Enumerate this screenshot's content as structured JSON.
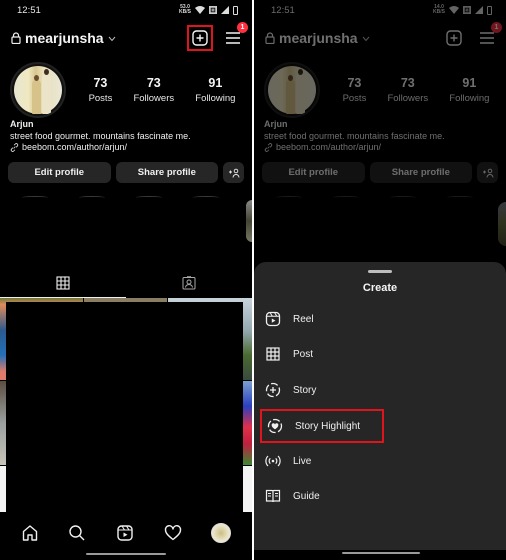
{
  "status_bar_left": {
    "time": "12:51",
    "net_speed_value": "53.0",
    "net_speed_unit": "KB/S"
  },
  "status_bar_right": {
    "time": "12:51",
    "net_speed_value": "14.0",
    "net_speed_unit": "KB/S"
  },
  "profile": {
    "username": "mearjunsha",
    "notification_count": "1",
    "stats": [
      {
        "value": "73",
        "label": "Posts"
      },
      {
        "value": "73",
        "label": "Followers"
      },
      {
        "value": "91",
        "label": "Following"
      }
    ],
    "name": "Arjun",
    "bio": "street food gourmet. mountains fascinate me.",
    "link": "beebom.com/author/arjun/"
  },
  "buttons": {
    "edit_profile": "Edit profile",
    "share_profile": "Share profile"
  },
  "create_sheet": {
    "title": "Create",
    "items": [
      {
        "icon": "reel-icon",
        "label": "Reel"
      },
      {
        "icon": "grid-icon",
        "label": "Post"
      },
      {
        "icon": "story-add-icon",
        "label": "Story"
      },
      {
        "icon": "story-highlight-icon",
        "label": "Story Highlight",
        "highlighted": true
      },
      {
        "icon": "live-icon",
        "label": "Live"
      },
      {
        "icon": "guide-icon",
        "label": "Guide"
      }
    ]
  },
  "colors": {
    "background": "#000000",
    "sheet": "#262626",
    "button": "#262626",
    "highlight_box": "#e0141c",
    "badge": "#ff3040"
  }
}
